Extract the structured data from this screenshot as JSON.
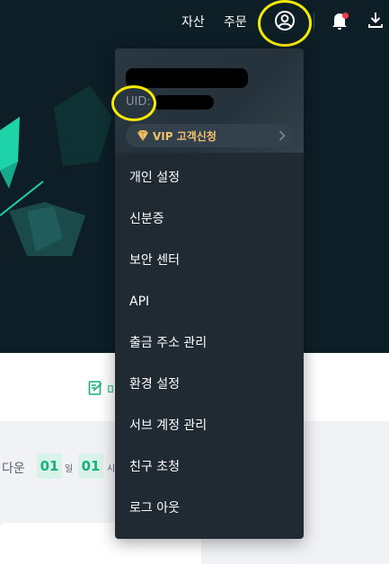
{
  "nav": {
    "assets_label": "자산",
    "orders_label": "주문"
  },
  "account_menu": {
    "uid_label": "UID:",
    "vip_label": "VIP 고객신청",
    "items": [
      {
        "label": "개인 설정"
      },
      {
        "label": "신분증"
      },
      {
        "label": "보안 센터"
      },
      {
        "label": "API"
      },
      {
        "label": "출금 주소 관리"
      },
      {
        "label": "환경 설정"
      },
      {
        "label": "서브 계정 관리"
      },
      {
        "label": "친구 초청"
      },
      {
        "label": "로그 아웃"
      }
    ]
  },
  "background": {
    "edit_text": "미",
    "countdown_label": "다운",
    "countdown_values": [
      "01",
      "01"
    ],
    "countdown_units": [
      "일",
      "시"
    ]
  },
  "colors": {
    "nav_bg": "#0d1e26",
    "menu_bg": "#1f2a33",
    "accent_green": "#17b07a",
    "vip_gold": "#f2c36b",
    "highlight_yellow": "#f6ea00",
    "notification_dot": "#f23a4d"
  },
  "icons": [
    "user-account-icon",
    "bell-icon",
    "download-icon",
    "vip-diamond-icon",
    "chevron-right-icon",
    "edit-icon"
  ]
}
